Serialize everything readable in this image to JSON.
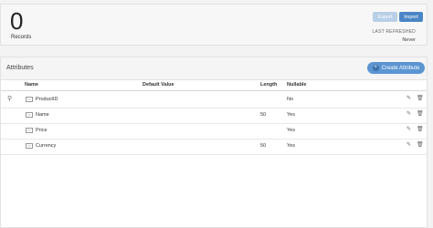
{
  "summary": {
    "count": "0",
    "records_label": "Records",
    "export_label": "Export",
    "import_label": "Import",
    "last_refreshed_label": "LAST REFRESHED",
    "last_refreshed_value": "Never"
  },
  "attributes": {
    "title": "Attributes",
    "create_label": "Create Attribute",
    "columns": {
      "name": "Name",
      "default_value": "Default Value",
      "length": "Length",
      "nullable": "Nullable"
    },
    "rows": [
      {
        "name": "ProductID",
        "default_value": "",
        "length": "",
        "nullable": "No",
        "is_key": true,
        "type_icon": "id-icon"
      },
      {
        "name": "Name",
        "default_value": "",
        "length": "50",
        "nullable": "Yes",
        "is_key": false,
        "type_icon": "text-icon"
      },
      {
        "name": "Price",
        "default_value": "",
        "length": "",
        "nullable": "Yes",
        "is_key": false,
        "type_icon": "number-icon"
      },
      {
        "name": "Currency",
        "default_value": "",
        "length": "50",
        "nullable": "Yes",
        "is_key": false,
        "type_icon": "text-icon"
      }
    ]
  },
  "colors": {
    "primary": "#4a86c5",
    "primary_disabled": "#b8cfe6",
    "create_button": "#5b95d2"
  }
}
